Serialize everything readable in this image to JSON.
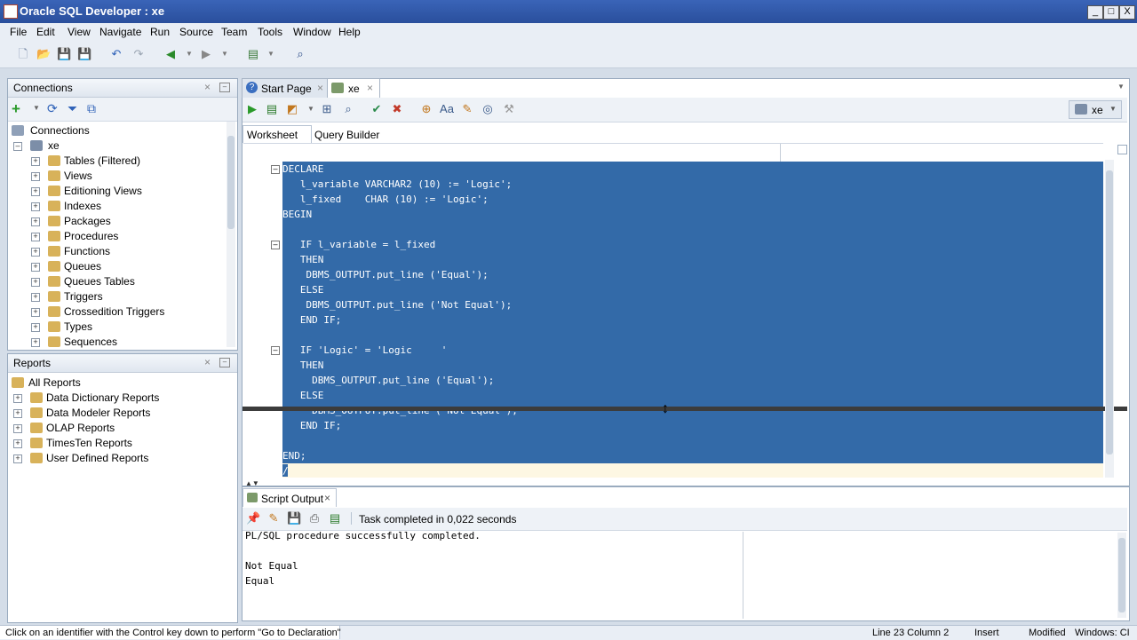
{
  "window": {
    "title": "Oracle SQL Developer : xe",
    "min": "_",
    "max": "□",
    "close": "X"
  },
  "menu": [
    "File",
    "Edit",
    "View",
    "Navigate",
    "Run",
    "Source",
    "Team",
    "Tools",
    "Window",
    "Help"
  ],
  "connections": {
    "title": "Connections",
    "root": "Connections",
    "conn": "xe",
    "items": [
      "Tables (Filtered)",
      "Views",
      "Editioning Views",
      "Indexes",
      "Packages",
      "Procedures",
      "Functions",
      "Queues",
      "Queues Tables",
      "Triggers",
      "Crossedition Triggers",
      "Types",
      "Sequences"
    ]
  },
  "reports": {
    "title": "Reports",
    "root": "All Reports",
    "items": [
      "Data Dictionary Reports",
      "Data Modeler Reports",
      "OLAP Reports",
      "TimesTen Reports",
      "User Defined Reports"
    ]
  },
  "tabs": {
    "start": "Start Page",
    "xe": "xe"
  },
  "editor": {
    "subtabs": {
      "worksheet": "Worksheet",
      "query_builder": "Query Builder"
    },
    "conn_selector": "xe",
    "lines": [
      "DECLARE",
      "   l_variable VARCHAR2 (10) := 'Logic';",
      "   l_fixed    CHAR (10) := 'Logic';",
      "BEGIN",
      "",
      "   IF l_variable = l_fixed",
      "   THEN",
      "    DBMS_OUTPUT.put_line ('Equal');",
      "   ELSE",
      "    DBMS_OUTPUT.put_line ('Not Equal');",
      "   END IF;",
      "",
      "   IF 'Logic' = 'Logic     '",
      "   THEN",
      "     DBMS_OUTPUT.put_line ('Equal');",
      "   ELSE",
      "     DBMS_OUTPUT.put_line ('Not Equal');",
      "   END IF;",
      "",
      "END;",
      "/"
    ]
  },
  "output": {
    "title": "Script Output",
    "status": "Task completed in 0,022 seconds",
    "lines": [
      "PL/SQL procedure successfully completed.",
      "",
      "Not Equal",
      "Equal"
    ]
  },
  "statusbar": {
    "hint": "Click on an identifier with the Control key down to perform \"Go to Declaration\"",
    "position": "Line 23 Column 2",
    "mode": "Insert",
    "modified": "Modified",
    "os": "Windows: CI"
  },
  "colors": {
    "selection": "#336aa8",
    "title_bar": "#2a4f9c",
    "panel_border": "#9aabbf"
  }
}
